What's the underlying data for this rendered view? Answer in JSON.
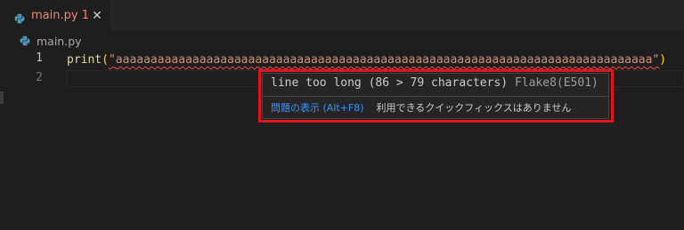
{
  "tab": {
    "title": "main.py",
    "problem_count": "1",
    "close_glyph": "✕",
    "icon": "python-icon"
  },
  "breadcrumb": {
    "file": "main.py",
    "icon": "python-icon"
  },
  "editor": {
    "line_numbers": [
      "1",
      "2"
    ],
    "code": {
      "fn": "print",
      "open": "(",
      "quote_open": "\"",
      "content": "aaaaaaaaaaaaaaaaaaaaaaaaaaaaaaaaaaaaaaaaaaaaaaaaaaaaaaaaaaaaaaaaaaaaaaaaaaaaa",
      "quote_close": "\"",
      "close": ")"
    }
  },
  "hover": {
    "message": "line too long (86 > 79 characters)",
    "source": "Flake8(E501)",
    "view_problem": "問題の表示 (Alt+F8)",
    "no_quick_fix": "利用できるクイックフィックスはありません"
  },
  "colors": {
    "error": "#f14c4c",
    "link": "#3794ff",
    "annotation_box": "#e3121c"
  }
}
